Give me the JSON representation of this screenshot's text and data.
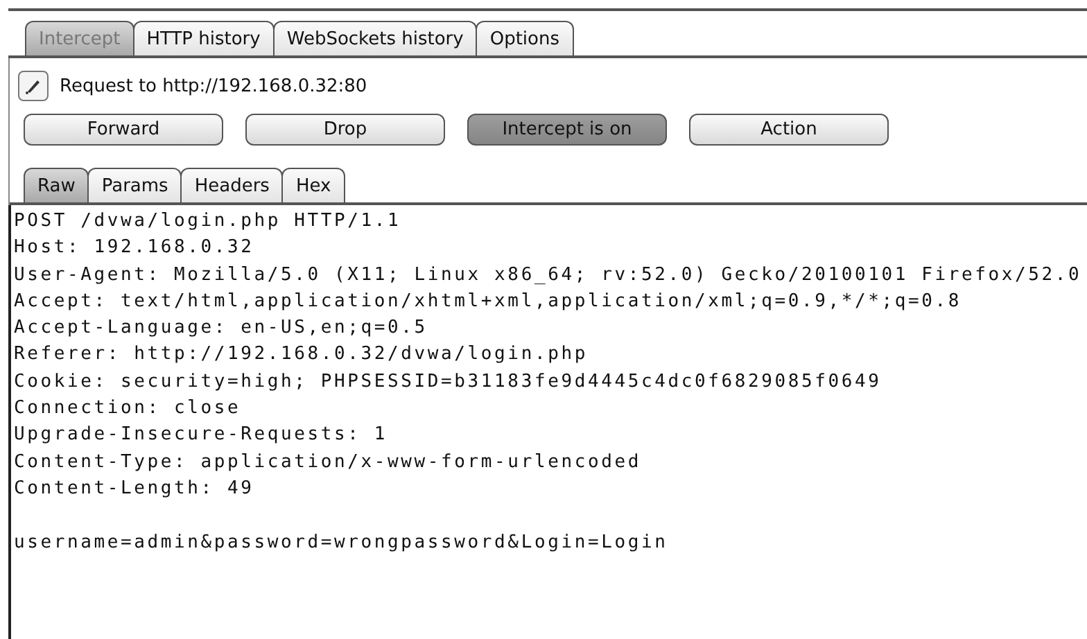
{
  "tabs": [
    {
      "label": "Intercept",
      "selected": true
    },
    {
      "label": "HTTP history",
      "selected": false
    },
    {
      "label": "WebSockets history",
      "selected": false
    },
    {
      "label": "Options",
      "selected": false
    }
  ],
  "request_label": "Request to http://192.168.0.32:80",
  "buttons": [
    {
      "label": "Forward",
      "on": false
    },
    {
      "label": "Drop",
      "on": false
    },
    {
      "label": "Intercept is on",
      "on": true
    },
    {
      "label": "Action",
      "on": false
    }
  ],
  "message_tabs": [
    {
      "label": "Raw",
      "selected": true
    },
    {
      "label": "Params",
      "selected": false
    },
    {
      "label": "Headers",
      "selected": false
    },
    {
      "label": "Hex",
      "selected": false
    }
  ],
  "request_lines": [
    "POST /dvwa/login.php HTTP/1.1",
    "Host: 192.168.0.32",
    "User-Agent: Mozilla/5.0 (X11; Linux x86_64; rv:52.0) Gecko/20100101 Firefox/52.0",
    "Accept: text/html,application/xhtml+xml,application/xml;q=0.9,*/*;q=0.8",
    "Accept-Language: en-US,en;q=0.5",
    "Referer: http://192.168.0.32/dvwa/login.php",
    "Cookie: security=high; PHPSESSID=b31183fe9d4445c4dc0f6829085f0649",
    "Connection: close",
    "Upgrade-Insecure-Requests: 1",
    "Content-Type: application/x-www-form-urlencoded",
    "Content-Length: 49"
  ],
  "request_body": "username=admin&password=wrongpassword&Login=Login"
}
